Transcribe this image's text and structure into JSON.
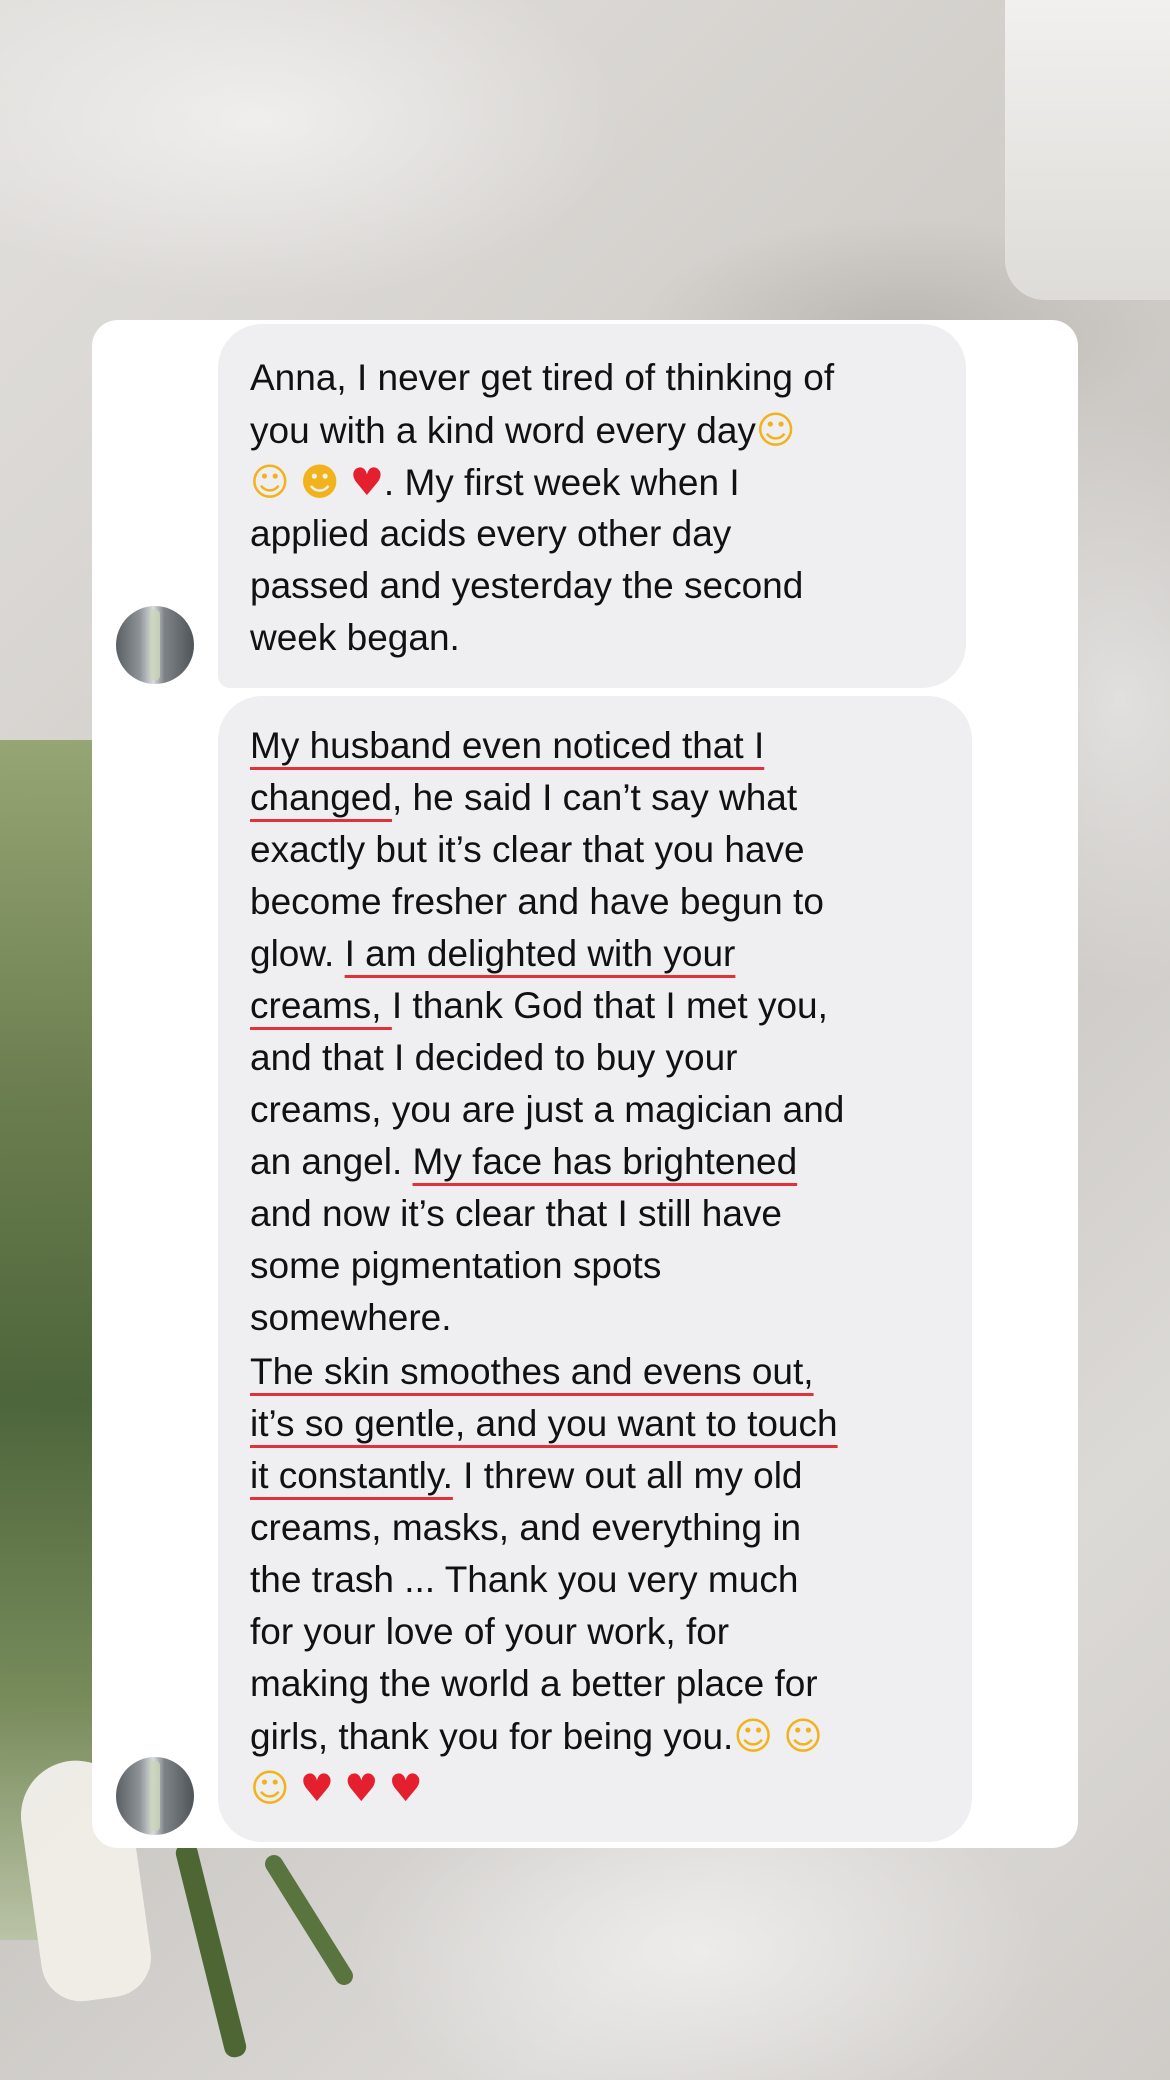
{
  "conversation": {
    "message_1": {
      "lines": [
        "Anna, I never get tired of thinking of",
        "you with a kind word every day",
        ". My first week when I",
        "applied acids every other day",
        "passed and yesterday the second",
        "week began."
      ],
      "emoji_after_line_2": "smiling-face-with-hearts",
      "emoji_line_3_prefix": [
        "hugging-face",
        "smiling-face-with-heart-eyes",
        "red-heart"
      ]
    },
    "message_2": {
      "l1_hl": "My husband even noticed that I",
      "l2_hl": "changed",
      "l2_rest": ", he said I can’t say what",
      "l3": "exactly but it’s clear that you have",
      "l4": "become fresher and have begun to",
      "l5_pre": "glow. ",
      "l5_hl": "I am delighted with your",
      "l6_hl": "creams, ",
      "l6_rest": "I thank God that I met you,",
      "l7": "and that I decided to buy your",
      "l8": "creams, you are just a magician and",
      "l9_pre": "an angel. ",
      "l9_hl": "My face has brightened",
      "l10": "and now it’s clear that I still have",
      "l11": "some pigmentation spots",
      "l12": "somewhere.",
      "l13_hl": "The skin smoothes and evens out,",
      "l14_hl": "it’s so gentle, and you want to touch",
      "l15_hl": "it constantly.",
      "l15_rest": " I threw out all my old",
      "l16": "creams, masks, and everything in",
      "l17": "the trash ... Thank you very much",
      "l18": "for your love of your work, for",
      "l19": "making the world a better place for",
      "l20": "girls, thank you for being you.",
      "closing_emojis": [
        "smiling-face-with-hearts",
        "smiling-face-with-hearts",
        "smiling-face-with-hearts",
        "red-heart",
        "red-heart",
        "red-heart"
      ]
    }
  },
  "colors": {
    "bubble": "#efeff1",
    "card": "#ffffff",
    "underline": "#e0313d",
    "text": "#111111"
  }
}
